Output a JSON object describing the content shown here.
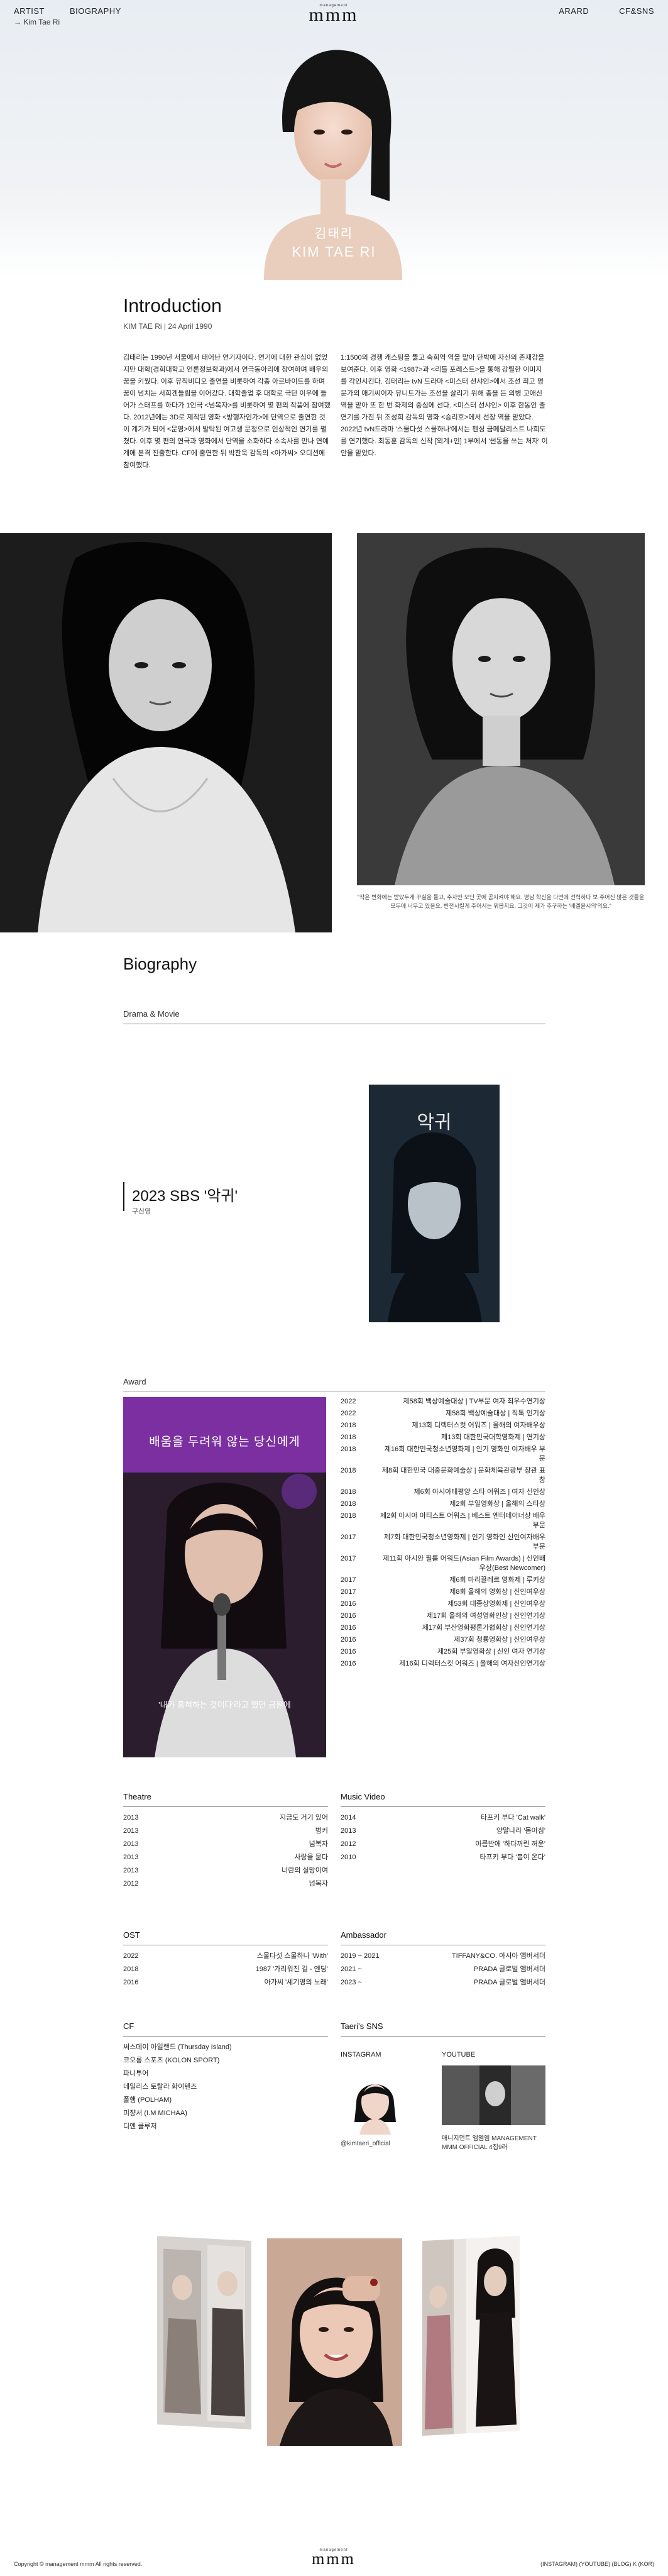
{
  "nav": {
    "artist": "ARTIST",
    "biography": "BIOGRAPHY",
    "breadcrumb": "→ Kim Tae Ri",
    "logo_small": "management",
    "logo_big": "mmm",
    "award": "ARARD",
    "cf_sns": "CF&SNS"
  },
  "hero": {
    "name_ko": "김태리",
    "name_en": "KIM TAE RI"
  },
  "intro": {
    "title": "Introduction",
    "meta": "KIM TAE Ri  |  24 April 1990",
    "left": "김태리는 1990년 서울에서 태어난 연기자이다. 연기에 대한 관심이 없었지만 대학(경희대학교 언론정보학과)에서 연극동아리에 참여하며 배우의 꿈을 키웠다. 이후 뮤직비디오 출연을 비롯하여 각종 아르바이트를 하며 꿈이 넘치는 서희겐들림을 이어갔다. 대학졸업 후 대학로 극단 이우에 들어가 스태프를 하다가 1인극 <넘복자>를 비롯하여 몇 편의 작품에 참여했다. 2012년에는 3D로 제작된 영화 <방행자인가>에 단역으로 출연한 것이 계기가 되어 <문영>에서 발탁된 여고생 문정으로 인상적인 연기를 펼쳤다. 이후 몇 편의 연극과 영화에서 단역을 소화하다 소속사를 만나 연예계에 본격 진출한다. CF에 출연한 뒤 박찬욱 감독의 <아가씨> 오디션에 참여했다.",
    "right": "1:1500의 경쟁 캐스팅을 뚫고 숙희역 역을 맡아 단박에 자신의 존재감을 보여준다. 이후 영화 <1987>과 <리틀 포레스트>을 통해 강렬한 이미지를 각인시킨다. 김태리는 tvN 드라마 <미스터 션샤인>에서 조선 최고 명문가의 애기씨이자 뮤니트가는 조선을 살리기 위해 총을 든 의병 고애신 역을 맡아 또 한 번 화제의 중심에 선다. <미스터 선샤인> 이후 한동안 출연기를 가진 뒤 조성희 감독의 영화 <승리호>에서 선장 역을 맡았다. 2022년 tvN드라마 '스물다섯 스물하나'에서는 펜싱 금메달리스트 나희도를 연기했다. 최동훈 감독의 신작 [외계+인] 1부에서 '썬동을 쓰는 처자' 이안을 맡았다."
  },
  "photo_caption": "\"작은 변화에는 받았두게 꾸실을 들고, 주자만 모딘 곳에 곰지켜야 해요. 명남 학신을 다면에 전력하다 보 주어진 많은 것들을 모두에 너무고 있을요. 반전시킬게 주어서는 뭐봅지요. 그것이 제가 추구하는 '배겔을시의'의요.\"",
  "bio": {
    "title": "Biography",
    "drama_heading": "Drama & Movie",
    "drama_title": "2023 SBS '악귀'",
    "drama_role": "구산영",
    "award_heading": "Award",
    "award_banner": "배움을 두려워 않는 당신에게",
    "award_subtitle": "'내가 흡혀하는 것이다'라고 했던 금원에",
    "awards": [
      {
        "year": "2022",
        "text": "제58회 백상예술대상 | TV부문 여자 최우수연기상"
      },
      {
        "year": "2022",
        "text": "제58회 백상예술대상 | 직톡 인기상"
      },
      {
        "year": "2018",
        "text": "제13회 디렉터스컷 어워즈 | 올해의 여자배우상"
      },
      {
        "year": "2018",
        "text": "제13회 대한민국대학영화제 | 연기상"
      },
      {
        "year": "2018",
        "text": "제16회 대한민국청소년영화제 | 인기 영화인 여자배우 부문"
      },
      {
        "year": "2018",
        "text": "제8회 대한민국 대중문화예술상 | 문화체육관광부 장관 표창"
      },
      {
        "year": "2018",
        "text": "제6회 아시아태평양 스타 어워즈 | 여자 신인상"
      },
      {
        "year": "2018",
        "text": "제2회 부일영화상 | 올해의 스타상"
      },
      {
        "year": "2018",
        "text": "제2회 아시아 아티스트 어워즈 | 베스트 엔터테이너상 배우부문"
      },
      {
        "year": "2017",
        "text": "제7회 대한민국청소년영화제 | 인기 영화인 신인여자배우 부문"
      },
      {
        "year": "2017",
        "text": "제11회 아시안 필름 어워드(Asian Film Awards) | 신인배우상(Best Newcomer)"
      },
      {
        "year": "2017",
        "text": "제6회 마리끌레르 영화제 | 루키상"
      },
      {
        "year": "2017",
        "text": "제8회 올해의 영화상 | 신인여우상"
      },
      {
        "year": "2016",
        "text": "제53회 대종상영화제 | 신인여우상"
      },
      {
        "year": "2016",
        "text": "제17회 올해의 여성영화인상 | 신인연기상"
      },
      {
        "year": "2016",
        "text": "제17회 부산영화평론가협회상 | 신인연기상"
      },
      {
        "year": "2016",
        "text": "제37회 청룡영화상 | 신인여우상"
      },
      {
        "year": "2016",
        "text": "제25회 부일영화상 | 신인 여자 연기상"
      },
      {
        "year": "2016",
        "text": "제16회 디렉터스컷 어워즈 | 올해의 여자신인연기상"
      }
    ],
    "theatre_heading": "Theatre",
    "theatre": [
      {
        "year": "2013",
        "text": "지금도 거기 있어"
      },
      {
        "year": "2013",
        "text": "벙커"
      },
      {
        "year": "2013",
        "text": "넘복자"
      },
      {
        "year": "2013",
        "text": "사랑을 묻다"
      },
      {
        "year": "2013",
        "text": "너란의 실망이여"
      },
      {
        "year": "2012",
        "text": "넘복자"
      }
    ],
    "mv_heading": "Music Video",
    "mv": [
      {
        "year": "2014",
        "text": "타프키 부다 'Cat walk'"
      },
      {
        "year": "2013",
        "text": "양말나라 '몸아침'"
      },
      {
        "year": "2012",
        "text": "아름반애 '하다꺼린 꺼운'"
      },
      {
        "year": "2010",
        "text": "타프키 부다 '봄이 온다'"
      }
    ],
    "ost_heading": "OST",
    "ost": [
      {
        "year": "2022",
        "text": "스물다섯 스물하나 'With'"
      },
      {
        "year": "2018",
        "text": "1987 '가리워진 길 - 엔딩'"
      },
      {
        "year": "2016",
        "text": "아가씨 '세기영의 노래'"
      }
    ],
    "amb_heading": "Ambassador",
    "amb": [
      {
        "year": "2019 ~ 2021",
        "text": "TIFFANY&CO. 아시아 앰버서더"
      },
      {
        "year": "2021 ~",
        "text": "PRADA 글로벌 앰버서더"
      },
      {
        "year": "2023 ~",
        "text": "PRADA 글로벌 앰버서더"
      }
    ],
    "cf_heading": "CF",
    "cf": [
      "써스데이 아일랜드 (Thursday Island)",
      "코오롱 스포츠 (KOLON SPORT)",
      "파니투어",
      "데일리스 토탈라 화이텐즈",
      "폴햄 (POLHAM)",
      "미쟝셔 (I.M MICHAA)",
      "디엔 클루저"
    ],
    "sns_heading": "Taeri's SNS",
    "instagram_label": "INSTAGRAM",
    "instagram_handle": "@kimtaeri_official",
    "youtube_label": "YOUTUBE",
    "youtube_caption": "매니지먼트 엠엠엠 MANAGEMENT MMM OFFICIAL 4집9러"
  },
  "footer": {
    "copyright": "Copyright © management mmm All rights reserved.",
    "logo_small": "management",
    "logo_big": "mmm",
    "links": "(INSTAGRAM)  (YOUTUBE)  (BLOG)  K  (KOR)"
  },
  "colors": {
    "hero_bg": "#e8edf3",
    "award_banner": "#7b2fa0",
    "text": "#222222"
  }
}
